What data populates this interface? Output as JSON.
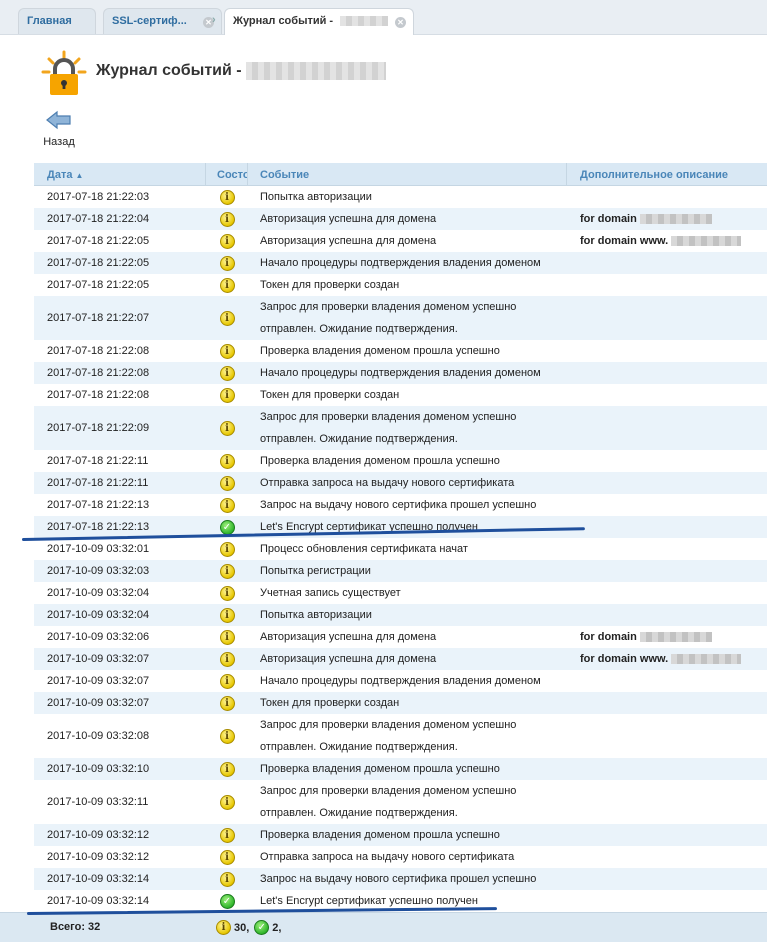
{
  "tabs": [
    {
      "label": "Главная"
    },
    {
      "label": "SSL-сертиф..."
    },
    {
      "label": "Журнал событий -"
    }
  ],
  "page": {
    "title": "Журнал событий -"
  },
  "toolbar": {
    "back_label": "Назад"
  },
  "table": {
    "columns": {
      "date": "Дата",
      "status": "Состо",
      "event": "Событие",
      "extra": "Дополнительное описание"
    },
    "rows": [
      {
        "date": "2017-07-18 21:22:03",
        "status": "info",
        "event": "Попытка авторизации",
        "extra": ""
      },
      {
        "date": "2017-07-18 21:22:04",
        "status": "info",
        "event": "Авторизация успешна для домена",
        "extra": "for domain"
      },
      {
        "date": "2017-07-18 21:22:05",
        "status": "info",
        "event": "Авторизация успешна для домена",
        "extra": "for domain www."
      },
      {
        "date": "2017-07-18 21:22:05",
        "status": "info",
        "event": "Начало процедуры подтверждения владения доменом",
        "extra": ""
      },
      {
        "date": "2017-07-18 21:22:05",
        "status": "info",
        "event": "Токен для проверки создан",
        "extra": ""
      },
      {
        "date": "2017-07-18 21:22:07",
        "status": "info",
        "event": "Запрос для проверки владения доменом успешно отправлен. Ожидание подтверждения.",
        "extra": "",
        "tall": true
      },
      {
        "date": "2017-07-18 21:22:08",
        "status": "info",
        "event": "Проверка владения доменом прошла успешно",
        "extra": ""
      },
      {
        "date": "2017-07-18 21:22:08",
        "status": "info",
        "event": "Начало процедуры подтверждения владения доменом",
        "extra": ""
      },
      {
        "date": "2017-07-18 21:22:08",
        "status": "info",
        "event": "Токен для проверки создан",
        "extra": ""
      },
      {
        "date": "2017-07-18 21:22:09",
        "status": "info",
        "event": "Запрос для проверки владения доменом успешно отправлен. Ожидание подтверждения.",
        "extra": "",
        "tall": true
      },
      {
        "date": "2017-07-18 21:22:11",
        "status": "info",
        "event": "Проверка владения доменом прошла успешно",
        "extra": ""
      },
      {
        "date": "2017-07-18 21:22:11",
        "status": "info",
        "event": "Отправка запроса на выдачу нового сертификата",
        "extra": ""
      },
      {
        "date": "2017-07-18 21:22:13",
        "status": "info",
        "event": "Запрос на выдачу нового сертифика прошел успешно",
        "extra": ""
      },
      {
        "date": "2017-07-18 21:22:13",
        "status": "ok",
        "event": "Let's Encrypt сертификат успешно получен",
        "extra": ""
      },
      {
        "date": "2017-10-09 03:32:01",
        "status": "info",
        "event": "Процесс обновления сертификата начат",
        "extra": ""
      },
      {
        "date": "2017-10-09 03:32:03",
        "status": "info",
        "event": "Попытка регистрации",
        "extra": ""
      },
      {
        "date": "2017-10-09 03:32:04",
        "status": "info",
        "event": "Учетная запись существует",
        "extra": ""
      },
      {
        "date": "2017-10-09 03:32:04",
        "status": "info",
        "event": "Попытка авторизации",
        "extra": ""
      },
      {
        "date": "2017-10-09 03:32:06",
        "status": "info",
        "event": "Авторизация успешна для домена",
        "extra": "for domain"
      },
      {
        "date": "2017-10-09 03:32:07",
        "status": "info",
        "event": "Авторизация успешна для домена",
        "extra": "for domain www."
      },
      {
        "date": "2017-10-09 03:32:07",
        "status": "info",
        "event": "Начало процедуры подтверждения владения доменом",
        "extra": ""
      },
      {
        "date": "2017-10-09 03:32:07",
        "status": "info",
        "event": "Токен для проверки создан",
        "extra": ""
      },
      {
        "date": "2017-10-09 03:32:08",
        "status": "info",
        "event": "Запрос для проверки владения доменом успешно отправлен. Ожидание подтверждения.",
        "extra": "",
        "tall": true
      },
      {
        "date": "2017-10-09 03:32:10",
        "status": "info",
        "event": "Проверка владения доменом прошла успешно",
        "extra": ""
      },
      {
        "date": "2017-10-09 03:32:11",
        "status": "info",
        "event": "Запрос для проверки владения доменом успешно отправлен. Ожидание подтверждения.",
        "extra": "",
        "tall": true
      },
      {
        "date": "2017-10-09 03:32:12",
        "status": "info",
        "event": "Проверка владения доменом прошла успешно",
        "extra": ""
      },
      {
        "date": "2017-10-09 03:32:12",
        "status": "info",
        "event": "Отправка запроса на выдачу нового сертификата",
        "extra": ""
      },
      {
        "date": "2017-10-09 03:32:14",
        "status": "info",
        "event": "Запрос на выдачу нового сертифика прошел успешно",
        "extra": ""
      },
      {
        "date": "2017-10-09 03:32:14",
        "status": "ok",
        "event": "Let's Encrypt сертификат успешно получен",
        "extra": ""
      }
    ]
  },
  "footer": {
    "total_label": "Всего: 32",
    "info_count": "30,",
    "ok_count": "2,"
  },
  "colors": {
    "header_bg": "#d9e8f4",
    "header_text": "#4a86b8",
    "row_alt": "#eaf3fa",
    "annotation_line": "#1f4f9c"
  }
}
